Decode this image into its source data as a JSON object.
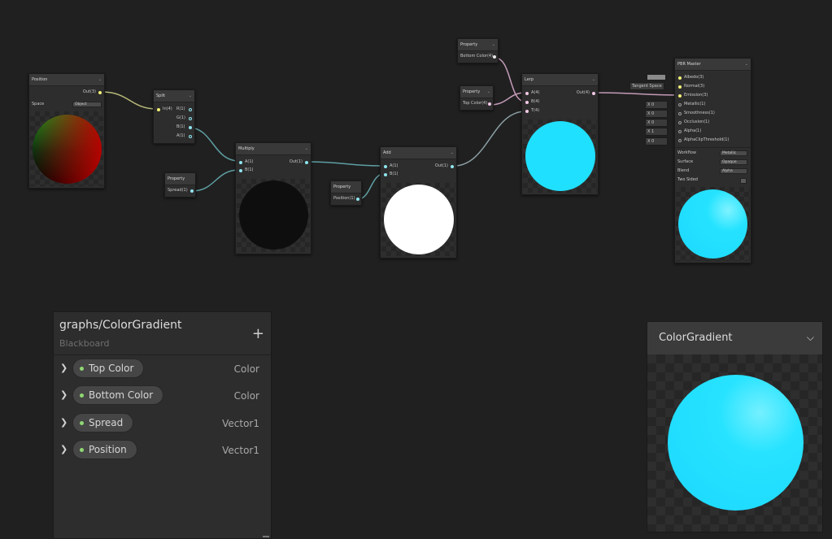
{
  "nodes": {
    "position": {
      "title": "Position",
      "out": "Out(3)",
      "space_label": "Space",
      "space_value": "Object"
    },
    "split": {
      "title": "Split",
      "in": "In(4)",
      "r": "R(1)",
      "g": "G(1)",
      "b": "B(1)",
      "a": "A(1)"
    },
    "property_spread": {
      "title": "Property",
      "out": "Spread(1)"
    },
    "multiply": {
      "title": "Multiply",
      "a": "A(1)",
      "b": "B(1)",
      "out": "Out(1)"
    },
    "property_position": {
      "title": "Property",
      "out": "Position(1)"
    },
    "add": {
      "title": "Add",
      "a": "A(1)",
      "b": "B(1)",
      "out": "Out(1)"
    },
    "property_bottom": {
      "title": "Property",
      "out": "Bottom Color(4)"
    },
    "property_top": {
      "title": "Property",
      "out": "Top Color(4)"
    },
    "lerp": {
      "title": "Lerp",
      "a": "A(4)",
      "b": "B(4)",
      "t": "T(4)",
      "out": "Out(4)"
    },
    "pbr": {
      "title": "PBR Master",
      "inputs": [
        "Albedo(3)",
        "Normal(3)",
        "Emission(3)",
        "Metallic(1)",
        "Smoothness(1)",
        "Occlusion(1)",
        "Alpha(1)",
        "AlphaClipThreshold(1)"
      ],
      "normal_tag": "Tangent Space",
      "metallic_tag": "X 0",
      "smoothness_tag": "X 0",
      "occlusion_tag": "X 0",
      "alpha_tag": "X 1",
      "alphaclip_tag": "X 0",
      "workflow_label": "Workflow",
      "workflow_value": "Metallic",
      "surface_label": "Surface",
      "surface_value": "Opaque",
      "blend_label": "Blend",
      "blend_value": "Alpha",
      "twosided_label": "Two Sided"
    }
  },
  "blackboard": {
    "title": "graphs/ColorGradient",
    "subtitle": "Blackboard",
    "add_icon": "plus-icon",
    "properties": [
      {
        "name": "Top Color",
        "type": "Color"
      },
      {
        "name": "Bottom Color",
        "type": "Color"
      },
      {
        "name": "Spread",
        "type": "Vector1"
      },
      {
        "name": "Position",
        "type": "Vector1"
      }
    ]
  },
  "preview": {
    "title": "ColorGradient",
    "chevron_icon": "chevron-down-icon"
  },
  "colors": {
    "background": "#202020",
    "node": "#2d2d2d",
    "wire_yellow": "#c8c874",
    "wire_cyan": "#6aa3a8",
    "wire_pink": "#c39bb8",
    "sphere_cyan": "#1fe0ff",
    "property_dot": "#8ed873"
  }
}
